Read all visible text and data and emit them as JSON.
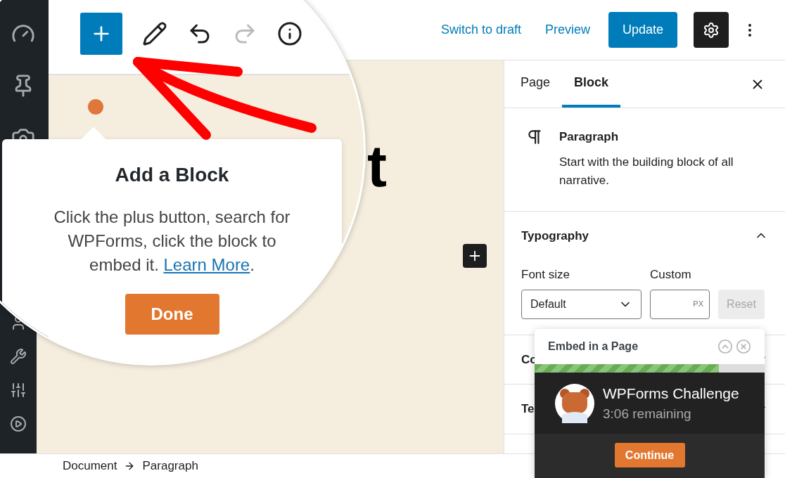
{
  "header": {
    "switch_to_draft": "Switch to draft",
    "preview": "Preview",
    "update": "Update",
    "settings_selected": true
  },
  "editor": {
    "heading_fragment": "t"
  },
  "tour": {
    "title": "Add a Block",
    "text": "Click the plus button, search for WPForms, click the block to embed it. ",
    "link": "Learn More",
    "suffix": ".",
    "button": "Done"
  },
  "sidebar": {
    "tabs": [
      {
        "label": "Page",
        "selected": false
      },
      {
        "label": "Block",
        "selected": true
      }
    ],
    "block": {
      "name": "Paragraph",
      "description": "Start with the building block of all narrative."
    },
    "panels": [
      {
        "title": "Typography",
        "expanded": true
      },
      {
        "title": "Co",
        "expanded": false
      },
      {
        "title": "Te",
        "expanded": false
      }
    ],
    "font_size": {
      "label": "Font size",
      "value": "Default"
    },
    "custom": {
      "label": "Custom",
      "unit": "PX"
    },
    "reset": {
      "label": "Reset",
      "disabled": true
    }
  },
  "challenge": {
    "title": "Embed in a Page",
    "level": 0.8,
    "name": "WPForms Challenge",
    "remaining": "3:06 remaining",
    "button": "Continue"
  },
  "breadcrumb": [
    "Document",
    "Paragraph"
  ]
}
